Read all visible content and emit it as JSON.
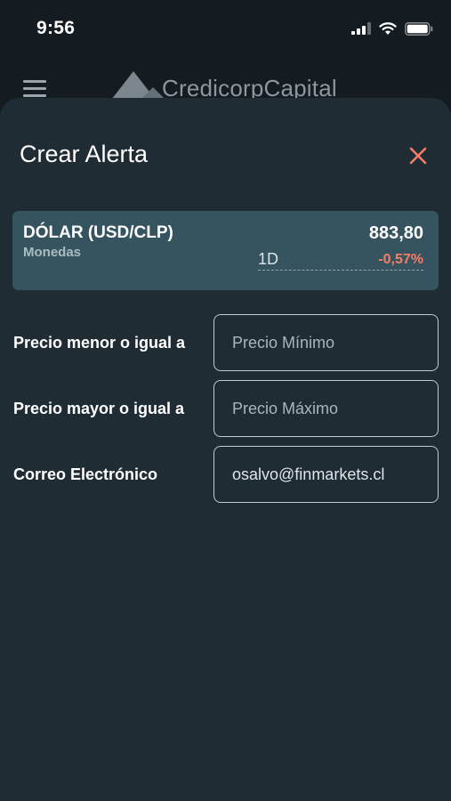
{
  "status_bar": {
    "time": "9:56"
  },
  "header": {
    "brand_name": "CredicorpCapital"
  },
  "modal": {
    "title": "Crear Alerta"
  },
  "asset": {
    "name": "DÓLAR (USD/CLP)",
    "category": "Monedas",
    "price": "883,80",
    "period": "1D",
    "change": "-0,57%",
    "change_color": "#f47d67"
  },
  "form": {
    "min_price": {
      "label": "Precio menor o igual a",
      "value": "",
      "placeholder": "Precio Mínimo"
    },
    "max_price": {
      "label": "Precio mayor o igual a",
      "value": "",
      "placeholder": "Precio Máximo"
    },
    "email": {
      "label": "Correo Electrónico",
      "value": "osalvo@finmarkets.cl",
      "placeholder": ""
    }
  },
  "icons": {
    "menu": "menu-icon",
    "close": "close-icon",
    "signal": "signal-icon",
    "wifi": "wifi-icon",
    "battery": "battery-icon",
    "logo": "mountain-logo-icon"
  },
  "colors": {
    "accent": "#f47d67",
    "sheet_background": "#1f2c33",
    "card_background": "#36545f"
  }
}
